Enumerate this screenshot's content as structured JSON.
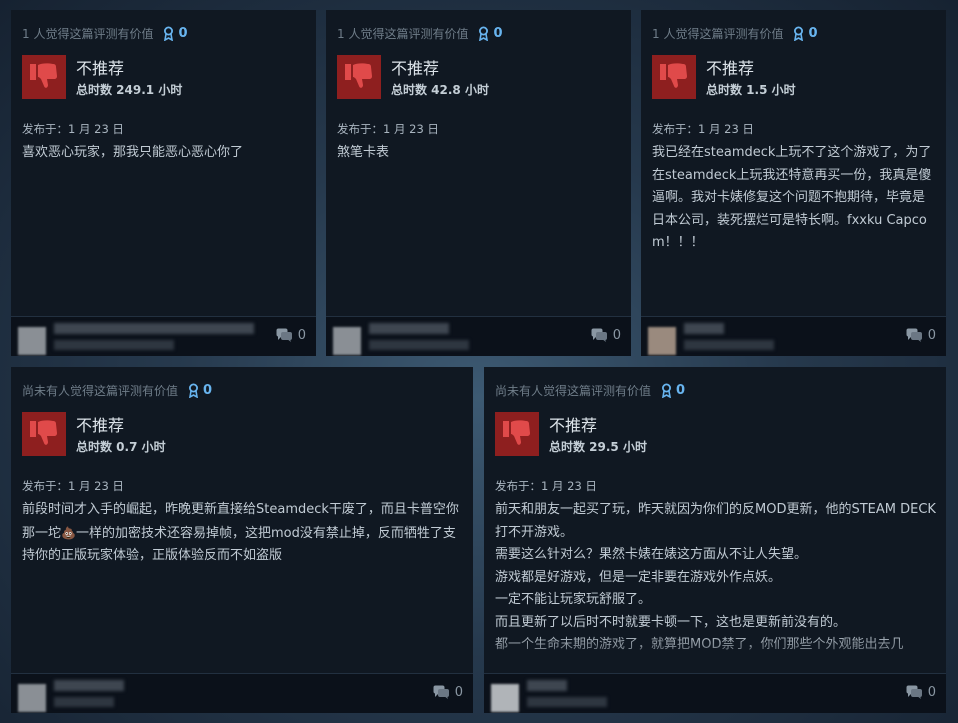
{
  "reviews": [
    {
      "helpful": "1 人觉得这篇评测有价值",
      "awards": "0",
      "verdict": "不推荐",
      "hours": "总时数 249.1 小时",
      "posted": "发布于：1 月 23 日",
      "content": [
        "喜欢恶心玩家，那我只能恶心恶心你了"
      ],
      "comments": "0"
    },
    {
      "helpful": "1 人觉得这篇评测有价值",
      "awards": "0",
      "verdict": "不推荐",
      "hours": "总时数 42.8 小时",
      "posted": "发布于：1 月 23 日",
      "content": [
        "煞笔卡表"
      ],
      "comments": "0"
    },
    {
      "helpful": "1 人觉得这篇评测有价值",
      "awards": "0",
      "verdict": "不推荐",
      "hours": "总时数 1.5 小时",
      "posted": "发布于：1 月 23 日",
      "content": [
        "我已经在steamdeck上玩不了这个游戏了，为了在steamdeck上玩我还特意再买一份，我真是傻逼啊。我对卡婊修复这个问题不抱期待，毕竟是日本公司，装死摆烂可是特长啊。fxxku Capcom！！！"
      ],
      "comments": "0"
    },
    {
      "helpful": "尚未有人觉得这篇评测有价值",
      "awards": "0",
      "verdict": "不推荐",
      "hours": "总时数 0.7 小时",
      "posted": "发布于：1 月 23 日",
      "content_a": "前段时间才入手的崛起，昨晚更新直接给Steamdeck干废了，而且卡普空你那一坨",
      "content_emoji": "💩",
      "content_b": "一样的加密技术还容易掉帧，这把mod没有禁止掉，反而牺牲了支持你的正版玩家体验，正版体验反而不如盗版",
      "comments": "0"
    },
    {
      "helpful": "尚未有人觉得这篇评测有价值",
      "awards": "0",
      "verdict": "不推荐",
      "hours": "总时数 29.5 小时",
      "posted": "发布于：1 月 23 日",
      "content": [
        "前天和朋友一起买了玩，昨天就因为你们的反MOD更新，他的STEAM DECK打不开游戏。",
        "需要这么针对么？果然卡婊在婊这方面从不让人失望。",
        "游戏都是好游戏，但是一定非要在游戏外作点妖。",
        "一定不能让玩家玩舒服了。",
        "而且更新了以后时不时就要卡顿一下，这也是更新前没有的。",
        "都一个生命末期的游戏了，就算把MOD禁了，你们那些个外观能出去几"
      ],
      "comments": "0"
    }
  ]
}
